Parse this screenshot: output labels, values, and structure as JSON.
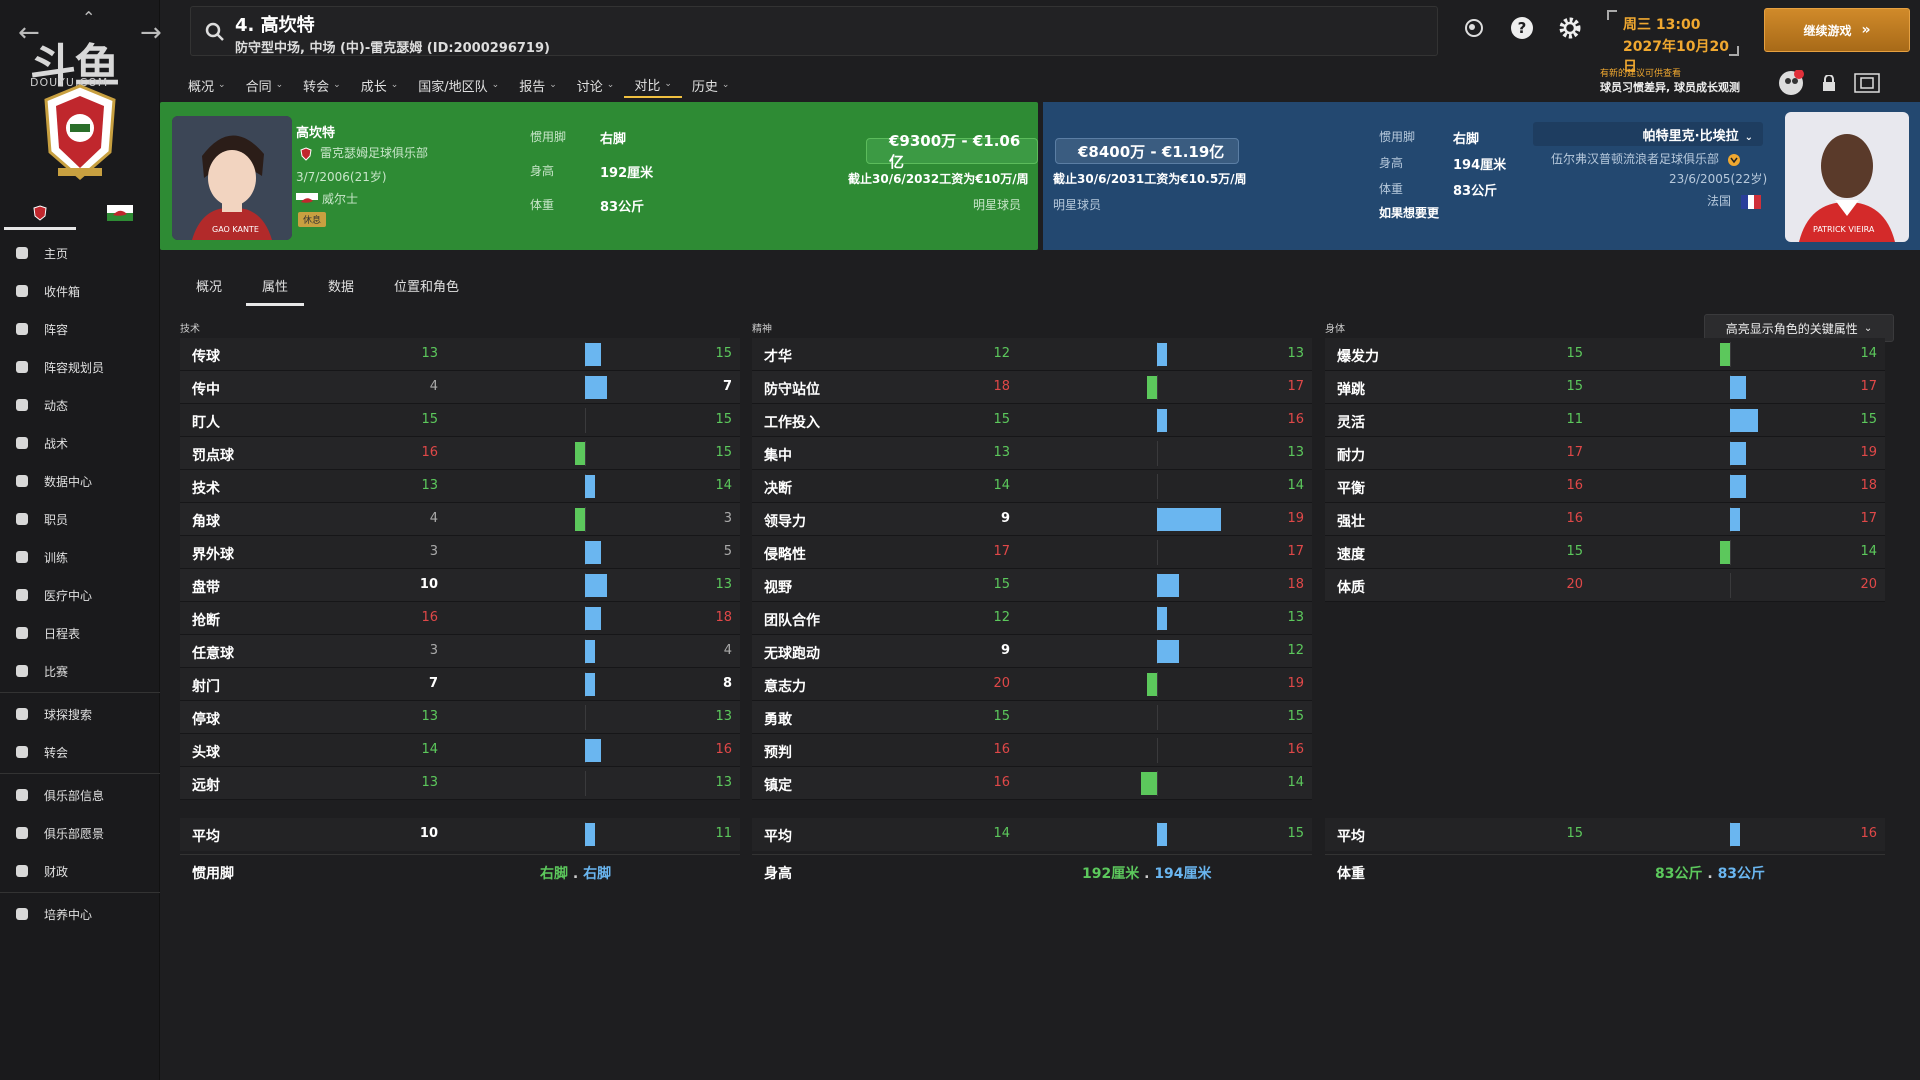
{
  "sidebar": {
    "logo_text": "斗鱼",
    "logo_sub": "DOUYU.COM",
    "items": [
      {
        "label": "主页",
        "icon": "home-icon"
      },
      {
        "label": "收件箱",
        "icon": "inbox-icon"
      },
      {
        "label": "阵容",
        "icon": "shirt-icon"
      },
      {
        "label": "阵容规划员",
        "icon": "clipboard-icon"
      },
      {
        "label": "动态",
        "icon": "dynamics-icon"
      },
      {
        "label": "战术",
        "icon": "tactics-icon"
      },
      {
        "label": "数据中心",
        "icon": "data-icon"
      },
      {
        "label": "职员",
        "icon": "staff-icon"
      },
      {
        "label": "训练",
        "icon": "training-icon"
      },
      {
        "label": "医疗中心",
        "icon": "medical-icon"
      },
      {
        "label": "日程表",
        "icon": "calendar-icon"
      },
      {
        "label": "比赛",
        "icon": "trophy-icon"
      },
      {
        "label": "球探搜索",
        "icon": "scout-search-icon"
      },
      {
        "label": "转会",
        "icon": "transfer-icon"
      },
      {
        "label": "俱乐部信息",
        "icon": "club-info-icon"
      },
      {
        "label": "俱乐部愿景",
        "icon": "club-vision-icon"
      },
      {
        "label": "财政",
        "icon": "finance-icon"
      },
      {
        "label": "培养中心",
        "icon": "development-icon"
      }
    ]
  },
  "header": {
    "player_title": "4. 高坎特",
    "player_sub": "防守型中场, 中场 (中)-雷克瑟姆 (ID:2000296719)",
    "date_line1": "周三 13:00",
    "date_line2": "2027年10月20日",
    "continue_label": "继续游戏",
    "notice_line1": "有新的建议可供查看",
    "notice_line2": "球员习惯差异, 球员成长观测"
  },
  "subnav": [
    {
      "label": "概况"
    },
    {
      "label": "合同"
    },
    {
      "label": "转会"
    },
    {
      "label": "成长"
    },
    {
      "label": "国家/地区队"
    },
    {
      "label": "报告"
    },
    {
      "label": "讨论"
    },
    {
      "label": "对比"
    },
    {
      "label": "历史"
    }
  ],
  "left_player": {
    "name": "高坎特",
    "club": "雷克瑟姆足球俱乐部",
    "birth": "3/7/2006(21岁)",
    "nation": "威尔士",
    "status_badge": "休息",
    "foot_label": "惯用脚",
    "foot": "右脚",
    "height_label": "身高",
    "height": "192厘米",
    "weight_label": "体重",
    "weight": "83公斤",
    "value": "€9300万 - €1.06亿",
    "contract": "截止30/6/2032工资为€10万/周",
    "star": "明星球员",
    "shirt_name": "GAO KANTE"
  },
  "right_player": {
    "name": "帕特里克·比埃拉",
    "club": "伍尔弗汉普顿流浪者足球俱乐部",
    "birth": "23/6/2005(22岁)",
    "nation": "法国",
    "foot_label": "惯用脚",
    "foot": "右脚",
    "height_label": "身高",
    "height": "194厘米",
    "weight_label": "体重",
    "weight": "83公斤",
    "value": "€8400万 - €1.19亿",
    "contract": "截止30/6/2031工资为€10.5万/周",
    "star": "明星球员",
    "note": "如果想要更",
    "shirt_name": "PATRICK VIEIRA"
  },
  "tabs": [
    {
      "label": "概况"
    },
    {
      "label": "属性"
    },
    {
      "label": "数据"
    },
    {
      "label": "位置和角色"
    }
  ],
  "highlight_label": "高亮显示角色的关键属性",
  "columns": [
    {
      "title": "技术",
      "rows": [
        {
          "name": "传球",
          "a": 13,
          "b": 15
        },
        {
          "name": "传中",
          "a": 4,
          "b": 7
        },
        {
          "name": "盯人",
          "a": 15,
          "b": 15
        },
        {
          "name": "罚点球",
          "a": 16,
          "b": 15
        },
        {
          "name": "技术",
          "a": 13,
          "b": 14
        },
        {
          "name": "角球",
          "a": 4,
          "b": 3
        },
        {
          "name": "界外球",
          "a": 3,
          "b": 5
        },
        {
          "name": "盘带",
          "a": 10,
          "b": 13
        },
        {
          "name": "抢断",
          "a": 16,
          "b": 18
        },
        {
          "name": "任意球",
          "a": 3,
          "b": 4
        },
        {
          "name": "射门",
          "a": 7,
          "b": 8
        },
        {
          "name": "停球",
          "a": 13,
          "b": 13
        },
        {
          "name": "头球",
          "a": 14,
          "b": 16
        },
        {
          "name": "远射",
          "a": 13,
          "b": 13
        }
      ],
      "avg": {
        "name": "平均",
        "a": 10,
        "b": 11
      },
      "footer": {
        "label": "惯用脚",
        "a": "右脚",
        "sep": " . ",
        "b": "右脚"
      }
    },
    {
      "title": "精神",
      "rows": [
        {
          "name": "才华",
          "a": 12,
          "b": 13
        },
        {
          "name": "防守站位",
          "a": 18,
          "b": 17
        },
        {
          "name": "工作投入",
          "a": 15,
          "b": 16
        },
        {
          "name": "集中",
          "a": 13,
          "b": 13
        },
        {
          "name": "决断",
          "a": 14,
          "b": 14
        },
        {
          "name": "领导力",
          "a": 9,
          "b": 19
        },
        {
          "name": "侵略性",
          "a": 17,
          "b": 17
        },
        {
          "name": "视野",
          "a": 15,
          "b": 18
        },
        {
          "name": "团队合作",
          "a": 12,
          "b": 13
        },
        {
          "name": "无球跑动",
          "a": 9,
          "b": 12
        },
        {
          "name": "意志力",
          "a": 20,
          "b": 19
        },
        {
          "name": "勇敢",
          "a": 15,
          "b": 15
        },
        {
          "name": "预判",
          "a": 16,
          "b": 16
        },
        {
          "name": "镇定",
          "a": 16,
          "b": 14
        }
      ],
      "avg": {
        "name": "平均",
        "a": 14,
        "b": 15
      },
      "footer": {
        "label": "身高",
        "a": "192厘米",
        "sep": " . ",
        "b": "194厘米"
      }
    },
    {
      "title": "身体",
      "rows": [
        {
          "name": "爆发力",
          "a": 15,
          "b": 14
        },
        {
          "name": "弹跳",
          "a": 15,
          "b": 17
        },
        {
          "name": "灵活",
          "a": 11,
          "b": 15
        },
        {
          "name": "耐力",
          "a": 17,
          "b": 19
        },
        {
          "name": "平衡",
          "a": 16,
          "b": 18
        },
        {
          "name": "强壮",
          "a": 16,
          "b": 17
        },
        {
          "name": "速度",
          "a": 15,
          "b": 14
        },
        {
          "name": "体质",
          "a": 20,
          "b": 20
        }
      ],
      "avg": {
        "name": "平均",
        "a": 15,
        "b": 16
      },
      "footer": {
        "label": "体重",
        "a": "83公斤",
        "sep": " . ",
        "b": "83公斤"
      }
    }
  ],
  "colors": {
    "green": "#5cc85c",
    "blue": "#6ab6f0",
    "red": "#e04848",
    "left_card": "#2e8b34",
    "right_card": "#234870",
    "accent": "#f0a830"
  }
}
